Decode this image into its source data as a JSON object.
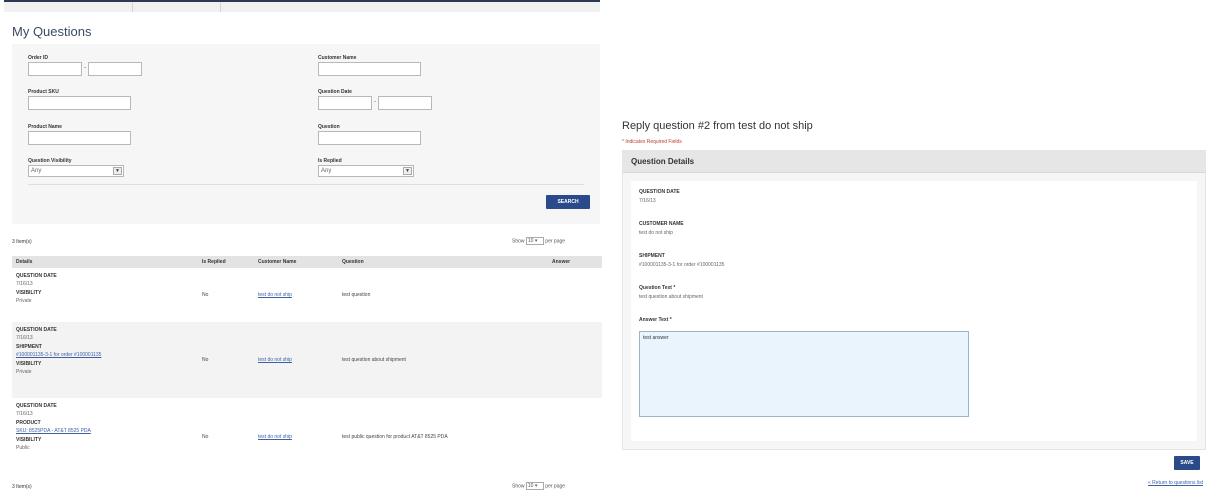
{
  "questions_page": {
    "title": "My Questions",
    "filters": {
      "order_id_label": "Order ID",
      "customer_name_label": "Customer Name",
      "product_sku_label": "Product SKU",
      "question_date_label": "Question Date",
      "product_name_label": "Product Name",
      "question_label": "Question",
      "question_visibility_label": "Question Visibility",
      "question_visibility_value": "Any",
      "is_replied_label": "Is Replied",
      "is_replied_value": "Any",
      "range_separator": "-",
      "search_button": "SEARCH"
    },
    "items_count": "3 Item(s)",
    "pager": {
      "show": "Show",
      "per_page_value": "10",
      "per_page": "per page"
    },
    "columns": [
      "Details",
      "Is Replied",
      "Customer Name",
      "Question",
      "Answer"
    ],
    "rows": [
      {
        "question_date_label": "QUESTION DATE",
        "question_date": "7/16/13",
        "visibility_label": "VISIBILITY",
        "visibility": "Private",
        "is_replied": "No",
        "customer_name": "test do not ship",
        "question": "test question",
        "answer": ""
      },
      {
        "question_date_label": "QUESTION DATE",
        "question_date": "7/16/13",
        "extra_label": "SHIPMENT",
        "extra_value": "#100001135-3-1 for order #100001135",
        "visibility_label": "VISIBILITY",
        "visibility": "Private",
        "is_replied": "No",
        "customer_name": "test do not ship",
        "question": "test question about shipment",
        "answer": ""
      },
      {
        "question_date_label": "QUESTION DATE",
        "question_date": "7/16/13",
        "extra_label": "PRODUCT",
        "extra_value": "SKU: 8525PDA - AT&T 8525 PDA",
        "visibility_label": "VISIBILITY",
        "visibility": "Public",
        "is_replied": "No",
        "customer_name": "test do not ship",
        "question": "test public question for product AT&T 8525 PDA",
        "answer": ""
      }
    ],
    "footer_count": "3 Item(s)"
  },
  "reply_page": {
    "title": "Reply question #2 from test do not ship",
    "required_note": "* Indicates Required Fields",
    "section_title": "Question Details",
    "question_date_label": "QUESTION DATE",
    "question_date": "7/16/13",
    "customer_name_label": "CUSTOMER NAME",
    "customer_name": "test do not ship",
    "shipment_label": "SHIPMENT",
    "shipment": "#100001135-3-1 for order #100001135",
    "question_text_label": "Question Text *",
    "question_text": "test question about shipment",
    "answer_text_label": "Answer Text *",
    "answer_text": "test answer",
    "save_button": "SAVE",
    "back_link": "« Return to questions list"
  },
  "colors": {
    "brand_button": "#2b4a8a",
    "link": "#3d5fa8",
    "answer_bg": "#eaf4fc"
  }
}
